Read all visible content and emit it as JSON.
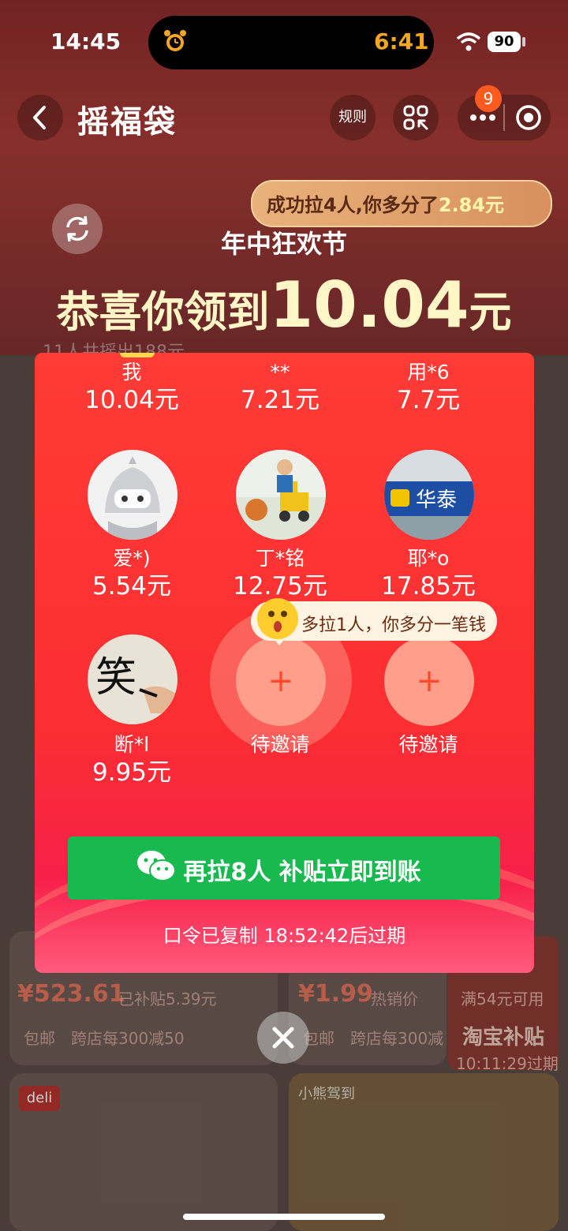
{
  "status_bar": {
    "time": "14:45",
    "island_time": "6:41",
    "battery": "90"
  },
  "header": {
    "title": "摇福袋",
    "rules_label": "规则",
    "badge_count": "9"
  },
  "banner": {
    "bubble_prefix": "成功拉4人,你多分了",
    "bubble_amount": "2.84元",
    "festival": "年中狂欢节",
    "congrats_prefix": "恭喜你领到",
    "congrats_amount": "10.04",
    "congrats_unit": "元"
  },
  "members": [
    {
      "name": "我",
      "amount": "10.04元"
    },
    {
      "name": "**",
      "amount": "7.21元"
    },
    {
      "name": "用*6",
      "amount": "7.7元"
    },
    {
      "name": "爱*)",
      "amount": "5.54元"
    },
    {
      "name": "丁*铭",
      "amount": "12.75元"
    },
    {
      "name": "耶*o",
      "amount": "17.85元"
    },
    {
      "name": "断*l",
      "amount": "9.95元"
    }
  ],
  "pending": [
    {
      "label": "待邀请",
      "plus": "+"
    },
    {
      "label": "待邀请",
      "plus": "+"
    }
  ],
  "hint": "多拉1人，你多分一笔钱",
  "avatar_text": {
    "huatai": "华泰",
    "xiao": "笑"
  },
  "wechat_button": "再拉8人 补贴立即到账",
  "expire_text": "口令已复制 18:52:42后过期",
  "background": {
    "shake_count": "11人共摇出188元",
    "price_left": "¥523.61",
    "subsidy_left": "已补贴5.39元",
    "price_right": "¥1.99",
    "hot_tag": "热销价",
    "free_ship": "包邮",
    "discount": "跨店每300减50",
    "promo_threshold": "满54元可用",
    "promo_title": "淘宝补贴",
    "promo_expire": "10:11:29过期",
    "brand_deli": "deli",
    "brand_bear": "小熊驾到"
  },
  "colors": {
    "accent_red": "#fb2e31",
    "wechat_green": "#18b94f",
    "gold": "#fff6c8"
  }
}
